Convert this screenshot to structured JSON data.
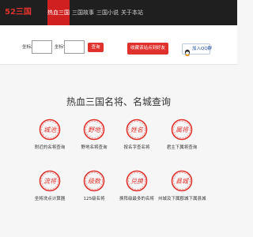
{
  "header": {
    "logo": "52三国",
    "nav": [
      {
        "label": "热血三国",
        "active": true
      },
      {
        "label": "三国故事",
        "active": false
      },
      {
        "label": "三国小说",
        "active": false
      },
      {
        "label": "关于本站",
        "active": false
      }
    ]
  },
  "toolbar": {
    "x_label": "坐标X:",
    "y_label": "坐标Y:",
    "x_value": "",
    "y_value": "",
    "query_label": "查询",
    "bookmark_label": "收藏该站点到好友",
    "qq_label": "加入QQ群",
    "qq_icon": "qq-group-icon"
  },
  "main": {
    "title": "热血三国名将、名城查询",
    "seal_color": "#e0322c",
    "features": [
      {
        "seal": "城池",
        "label": "附近的名将查询",
        "icon": "seal-city-icon"
      },
      {
        "seal": "野地",
        "label": "野地名将查询",
        "icon": "seal-wild-icon"
      },
      {
        "seal": "姓名",
        "label": "按名字查名将",
        "icon": "seal-name-icon"
      },
      {
        "seal": "属将",
        "label": "君主下属将查询",
        "icon": "seal-subordinate-icon"
      },
      {
        "seal": "流将",
        "label": "坐将洗点计算器",
        "icon": "seal-calc-icon"
      },
      {
        "seal": "级数",
        "label": "125级名将",
        "icon": "seal-level-icon"
      },
      {
        "seal": "兑换",
        "label": "换阵级最多的名将",
        "icon": "seal-exchange-icon"
      },
      {
        "seal": "县城",
        "label": "州城及下属郡城下属县城",
        "icon": "seal-county-icon"
      }
    ]
  }
}
